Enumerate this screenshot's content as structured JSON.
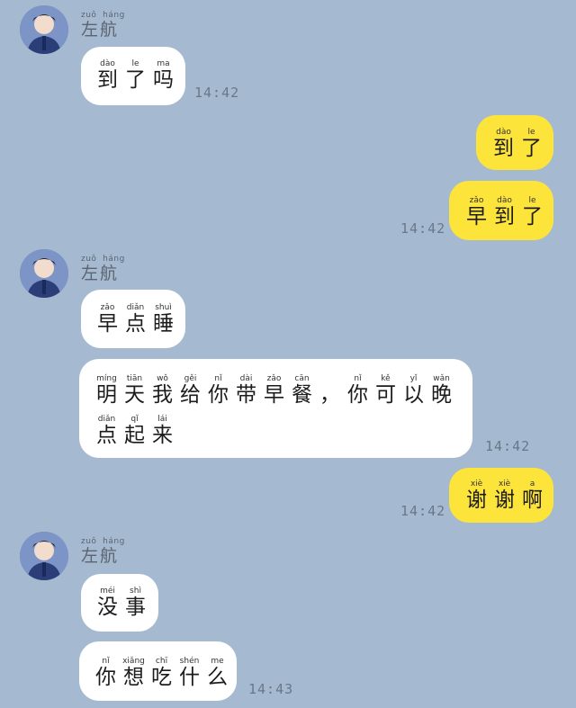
{
  "messages": [
    {
      "id": "m1",
      "side": "left",
      "sender": {
        "name": "左航",
        "pinyin": [
          "zuǒ",
          "háng"
        ]
      },
      "lines": [
        [
          [
            "到",
            "dào"
          ],
          [
            "了",
            "le"
          ],
          [
            "吗",
            "ma"
          ]
        ]
      ],
      "time": "14:42"
    },
    {
      "id": "m2",
      "side": "right",
      "lines": [
        [
          [
            "到",
            "dào"
          ],
          [
            "了",
            "le"
          ]
        ]
      ]
    },
    {
      "id": "m3",
      "side": "right",
      "lines": [
        [
          [
            "早",
            "zǎo"
          ],
          [
            "到",
            "dào"
          ],
          [
            "了",
            "le"
          ]
        ]
      ],
      "time": "14:42"
    },
    {
      "id": "m4",
      "side": "left",
      "sender": {
        "name": "左航",
        "pinyin": [
          "zuǒ",
          "háng"
        ]
      },
      "lines": [
        [
          [
            "早",
            "zǎo"
          ],
          [
            "点",
            "diǎn"
          ],
          [
            "睡",
            "shuì"
          ]
        ]
      ]
    },
    {
      "id": "m5",
      "side": "left",
      "lines": [
        [
          [
            "明",
            "míng"
          ],
          [
            "天",
            "tiān"
          ],
          [
            "我",
            "wǒ"
          ],
          [
            "给",
            "gěi"
          ],
          [
            "你",
            "nǐ"
          ],
          [
            "带",
            "dài"
          ],
          [
            "早",
            "zǎo"
          ],
          [
            "餐",
            "cān"
          ],
          [
            "，",
            ""
          ],
          [
            "你",
            "nǐ"
          ],
          [
            "可",
            "kě"
          ],
          [
            "以",
            "yǐ"
          ],
          [
            "晚",
            "wǎn"
          ]
        ],
        [
          [
            "点",
            "diǎn"
          ],
          [
            "起",
            "qǐ"
          ],
          [
            "来",
            "lái"
          ]
        ]
      ],
      "time": "14:42"
    },
    {
      "id": "m6",
      "side": "right",
      "lines": [
        [
          [
            "谢",
            "xiè"
          ],
          [
            "谢",
            "xiè"
          ],
          [
            "啊",
            "a"
          ]
        ]
      ],
      "time": "14:42"
    },
    {
      "id": "m7",
      "side": "left",
      "sender": {
        "name": "左航",
        "pinyin": [
          "zuǒ",
          "háng"
        ]
      },
      "lines": [
        [
          [
            "没",
            "méi"
          ],
          [
            "事",
            "shì"
          ]
        ]
      ]
    },
    {
      "id": "m8",
      "side": "left",
      "lines": [
        [
          [
            "你",
            "nǐ"
          ],
          [
            "想",
            "xiǎng"
          ],
          [
            "吃",
            "chī"
          ],
          [
            "什",
            "shén"
          ],
          [
            "么",
            "me"
          ]
        ]
      ],
      "time": "14:43"
    }
  ],
  "colors": {
    "background": "#a5bad1",
    "incoming": "#ffffff",
    "outgoing": "#fde43a",
    "time": "#6a7787"
  }
}
